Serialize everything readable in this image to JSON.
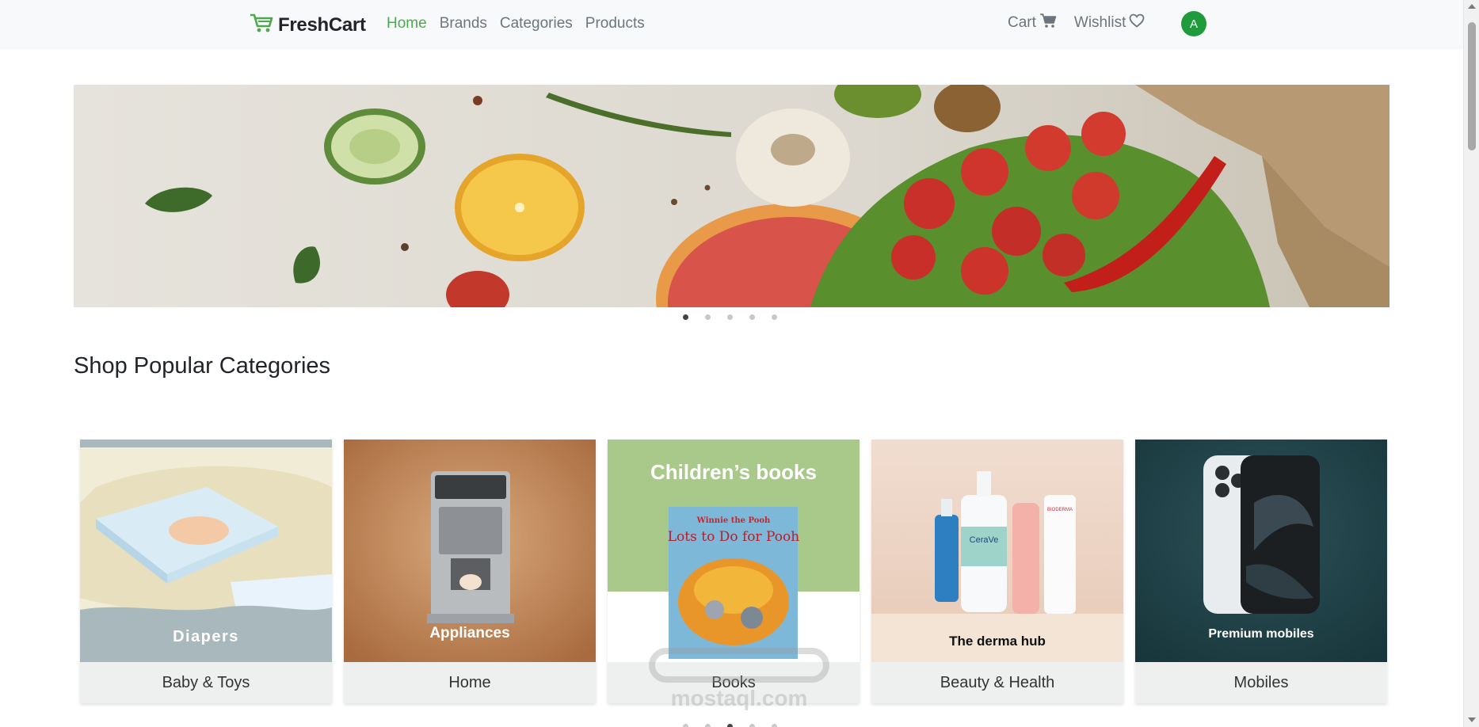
{
  "navbar": {
    "brand": "FreshCart",
    "links": [
      {
        "label": "Home",
        "active": true
      },
      {
        "label": "Brands",
        "active": false
      },
      {
        "label": "Categories",
        "active": false
      },
      {
        "label": "Products",
        "active": false
      }
    ],
    "cart_label": "Cart",
    "wishlist_label": "Wishlist",
    "avatar_initial": "A"
  },
  "colors": {
    "accent": "#4fa74f",
    "avatar": "#1e9b3a",
    "navbar_bg": "#f8f9fa"
  },
  "hero": {
    "slide_count": 5,
    "active_slide": 1
  },
  "section": {
    "title": "Shop Popular Categories"
  },
  "categories": [
    {
      "name": "Baby & Toys",
      "image_label": "Diapers"
    },
    {
      "name": "Home",
      "image_label": "Appliances"
    },
    {
      "name": "Books",
      "image_label": "Children’s books",
      "book_title": "Lots to Do for Pooh",
      "book_brand": "Winnie the Pooh"
    },
    {
      "name": "Beauty & Health",
      "image_label": "The derma hub",
      "products": [
        "CeraVe",
        "BIODERMA"
      ]
    },
    {
      "name": "Mobiles",
      "image_label": "Premium mobiles"
    }
  ],
  "carousel_bottom": {
    "dot_count": 5,
    "active_dot": 3
  },
  "watermark": "mostaql.com"
}
